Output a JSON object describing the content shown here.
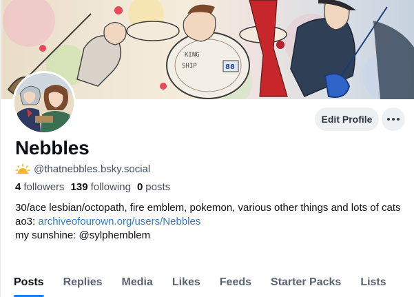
{
  "banner": {
    "alt": "illustrated band banner",
    "sign_text_1": "KING",
    "sign_text_2": "SHIP",
    "sign_text_3": "88"
  },
  "profile": {
    "display_name": "Nebbles",
    "handle": "@thatnebbles.bsky.social",
    "badge_icon": "sun-icon"
  },
  "actions": {
    "edit_label": "Edit Profile",
    "more_icon": "ellipsis-icon"
  },
  "stats": {
    "followers_count": "4",
    "followers_label": "followers",
    "following_count": "139",
    "following_label": "following",
    "posts_count": "0",
    "posts_label": "posts"
  },
  "bio": {
    "line1": "30/ace lesbian/octopath, fire emblem, pokemon, various other things and lots of cats",
    "ao3_prefix": "ao3: ",
    "ao3_link": "archiveofourown.org/users/Nebbles",
    "line3": "my sunshine: @sylphemblem"
  },
  "tabs": [
    {
      "label": "Posts",
      "active": true
    },
    {
      "label": "Replies",
      "active": false
    },
    {
      "label": "Media",
      "active": false
    },
    {
      "label": "Likes",
      "active": false
    },
    {
      "label": "Feeds",
      "active": false
    },
    {
      "label": "Starter Packs",
      "active": false
    },
    {
      "label": "Lists",
      "active": false
    }
  ],
  "colors": {
    "accent": "#1083fe",
    "link": "#2f7bd6",
    "button_bg": "#eef1f4",
    "muted_text": "#45515e"
  }
}
